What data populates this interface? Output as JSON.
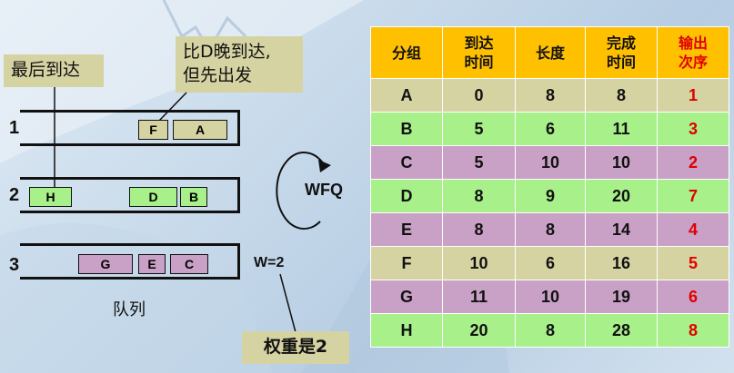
{
  "callouts": {
    "last_arrival": "最后到达",
    "f_note_line1": "比D晚到达,",
    "f_note_line2": "但先出发",
    "weight_note": "权重是2"
  },
  "queues": {
    "caption": "队列",
    "rows": [
      {
        "number": "1",
        "packets": [
          "F",
          "A"
        ]
      },
      {
        "number": "2",
        "packets": [
          "H",
          "D",
          "B"
        ]
      },
      {
        "number": "3",
        "packets": [
          "G",
          "E",
          "C"
        ]
      }
    ],
    "weight_label": "W=2"
  },
  "scheduler": {
    "label": "WFQ"
  },
  "table": {
    "headers": [
      [
        "分组"
      ],
      [
        "到达",
        "时间"
      ],
      [
        "长度"
      ],
      [
        "完成",
        "时间"
      ],
      [
        "输出",
        "次序"
      ]
    ],
    "rows": [
      {
        "packet": "A",
        "arrival": "0",
        "length": "8",
        "finish": "8",
        "order": "1"
      },
      {
        "packet": "B",
        "arrival": "5",
        "length": "6",
        "finish": "11",
        "order": "3"
      },
      {
        "packet": "C",
        "arrival": "5",
        "length": "10",
        "finish": "10",
        "order": "2"
      },
      {
        "packet": "D",
        "arrival": "8",
        "length": "9",
        "finish": "20",
        "order": "7"
      },
      {
        "packet": "E",
        "arrival": "8",
        "length": "8",
        "finish": "14",
        "order": "4"
      },
      {
        "packet": "F",
        "arrival": "10",
        "length": "6",
        "finish": "16",
        "order": "5"
      },
      {
        "packet": "G",
        "arrival": "11",
        "length": "10",
        "finish": "19",
        "order": "6"
      },
      {
        "packet": "H",
        "arrival": "20",
        "length": "8",
        "finish": "28",
        "order": "8"
      }
    ]
  },
  "colors": {
    "tan": "#d6d3a3",
    "green": "#a8f08a",
    "purple": "#c9a0c6",
    "header": "#ffc000",
    "order_red": "#e00000"
  }
}
